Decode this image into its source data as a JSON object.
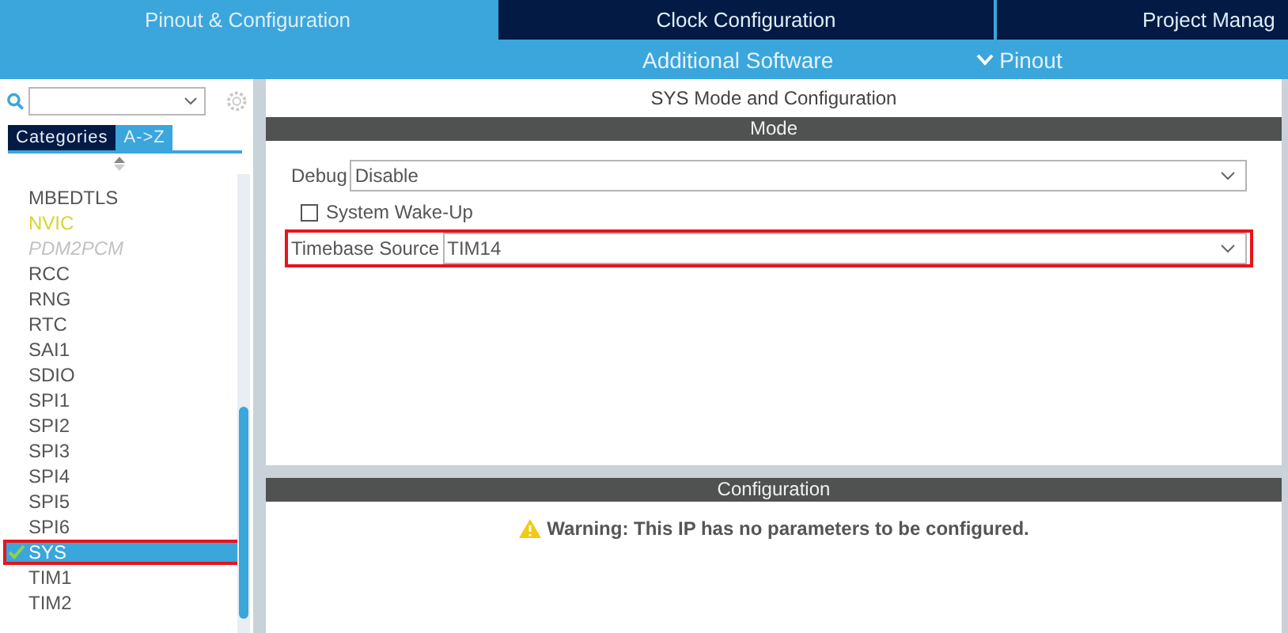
{
  "main_tabs": [
    {
      "label": "Pinout & Configuration",
      "selected": true
    },
    {
      "label": "Clock Configuration",
      "selected": false
    },
    {
      "label": "Project Manag",
      "selected": false
    }
  ],
  "sub_bar": {
    "additional": "Additional Software",
    "pinout": "Pinout"
  },
  "sidebar": {
    "view_tabs": [
      {
        "label": "Categories",
        "selected": false
      },
      {
        "label": "A->Z",
        "selected": true
      }
    ],
    "items": [
      {
        "label": "MBEDTLS",
        "kind": "normal",
        "checked": false,
        "selected": false,
        "highlighted": false
      },
      {
        "label": "NVIC",
        "kind": "configured",
        "checked": false,
        "selected": false,
        "highlighted": false
      },
      {
        "label": "PDM2PCM",
        "kind": "unavailable",
        "checked": false,
        "selected": false,
        "highlighted": false
      },
      {
        "label": "RCC",
        "kind": "normal",
        "checked": false,
        "selected": false,
        "highlighted": false
      },
      {
        "label": "RNG",
        "kind": "normal",
        "checked": false,
        "selected": false,
        "highlighted": false
      },
      {
        "label": "RTC",
        "kind": "normal",
        "checked": false,
        "selected": false,
        "highlighted": false
      },
      {
        "label": "SAI1",
        "kind": "normal",
        "checked": false,
        "selected": false,
        "highlighted": false
      },
      {
        "label": "SDIO",
        "kind": "normal",
        "checked": false,
        "selected": false,
        "highlighted": false
      },
      {
        "label": "SPI1",
        "kind": "normal",
        "checked": false,
        "selected": false,
        "highlighted": false
      },
      {
        "label": "SPI2",
        "kind": "normal",
        "checked": false,
        "selected": false,
        "highlighted": false
      },
      {
        "label": "SPI3",
        "kind": "normal",
        "checked": false,
        "selected": false,
        "highlighted": false
      },
      {
        "label": "SPI4",
        "kind": "normal",
        "checked": false,
        "selected": false,
        "highlighted": false
      },
      {
        "label": "SPI5",
        "kind": "normal",
        "checked": false,
        "selected": false,
        "highlighted": false
      },
      {
        "label": "SPI6",
        "kind": "normal",
        "checked": false,
        "selected": false,
        "highlighted": false
      },
      {
        "label": "SYS",
        "kind": "normal",
        "checked": true,
        "selected": true,
        "highlighted": true
      },
      {
        "label": "TIM1",
        "kind": "normal",
        "checked": false,
        "selected": false,
        "highlighted": false
      },
      {
        "label": "TIM2",
        "kind": "normal",
        "checked": false,
        "selected": false,
        "highlighted": false
      }
    ]
  },
  "panel": {
    "title": "SYS Mode and Configuration",
    "mode_header": "Mode",
    "fields": [
      {
        "kind": "select",
        "label": "Debug",
        "value": "Disable",
        "highlighted": false
      },
      {
        "kind": "checkbox",
        "label": "System Wake-Up",
        "checked": false
      },
      {
        "kind": "select",
        "label": "Timebase Source",
        "value": "TIM14",
        "highlighted": true
      }
    ],
    "config_header": "Configuration",
    "warning": "Warning: This IP has no parameters to be configured."
  }
}
